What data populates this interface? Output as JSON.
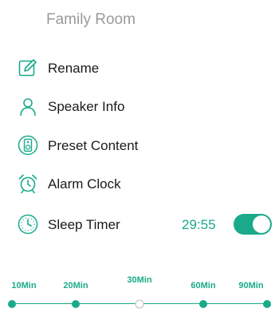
{
  "room": {
    "title": "Family Room"
  },
  "menu": [
    {
      "label": "Rename",
      "icon": "edit-icon"
    },
    {
      "label": "Speaker Info",
      "icon": "user-icon"
    },
    {
      "label": "Preset Content",
      "icon": "speaker-icon"
    },
    {
      "label": "Alarm Clock",
      "icon": "alarm-clock-icon"
    },
    {
      "label": "Sleep Timer",
      "icon": "timer-icon"
    }
  ],
  "sleep_timer": {
    "remaining": "29:55",
    "enabled": true
  },
  "slider": {
    "options": [
      "10Min",
      "20Min",
      "30Min",
      "60Min",
      "90Min"
    ],
    "selected": "30Min"
  },
  "colors": {
    "accent": "#1aaa8a",
    "title": "#9a9a9a"
  }
}
